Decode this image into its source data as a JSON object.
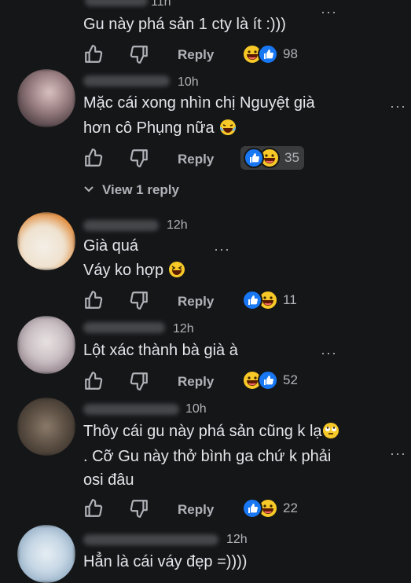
{
  "comments": [
    {
      "time": "11h",
      "lines": [
        "Gu này phá sản 1 cty là ít :)))"
      ],
      "reply": "Reply",
      "count": "98"
    },
    {
      "time": "10h",
      "lines": [
        "Mặc cái xong nhìn chị Nguyệt già",
        "hơn cô Phụng nữa"
      ],
      "reply": "Reply",
      "count": "35",
      "view_replies": "View 1 reply"
    },
    {
      "time": "12h",
      "lines": [
        "Già quá",
        "Váy ko hợp"
      ],
      "reply": "Reply",
      "count": "11"
    },
    {
      "time": "12h",
      "lines": [
        "Lột xác thành bà già à"
      ],
      "reply": "Reply",
      "count": "52"
    },
    {
      "time": "10h",
      "lines": [
        "Thôy cái gu này phá sản cũng k lạ",
        ". Cỡ Gu này thở bình ga chứ k phải",
        "osi đâu"
      ],
      "reply": "Reply",
      "count": "22"
    },
    {
      "time": "12h",
      "lines": [
        "Hẳn là cái váy đẹp =))))"
      ]
    }
  ],
  "icons": {
    "like": "thumbs-up-icon",
    "dislike": "thumbs-down-icon",
    "more": "more-options-icon",
    "reaction_like": "like-reaction-icon",
    "reaction_haha": "haha-reaction-icon"
  },
  "colors": {
    "background": "#151618",
    "text": "#e4e6eb",
    "muted": "#b0b3b8",
    "like_blue": "#1877f2",
    "haha_yellow": "#f7c928"
  }
}
